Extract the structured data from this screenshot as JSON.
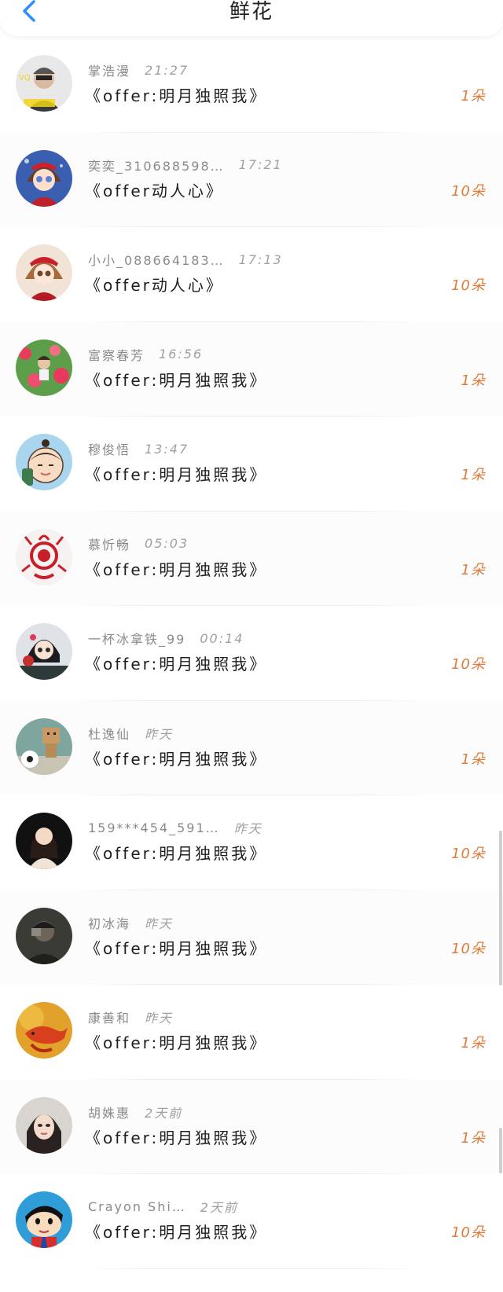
{
  "header": {
    "title": "鲜花",
    "back_icon": "chevron-left-icon",
    "accent": "#2f8cff"
  },
  "list": {
    "count_color": "#e07b3a",
    "items": [
      {
        "name": "掌浩漫",
        "time": "21:27",
        "gift": "《offer:明月独照我》",
        "count": "1朵"
      },
      {
        "name": "奕奕_310688598…",
        "time": "17:21",
        "gift": "《offer动人心》",
        "count": "10朵"
      },
      {
        "name": "小小_088664183…",
        "time": "17:13",
        "gift": "《offer动人心》",
        "count": "10朵"
      },
      {
        "name": "富察春芳",
        "time": "16:56",
        "gift": "《offer:明月独照我》",
        "count": "1朵"
      },
      {
        "name": "穆俊悟",
        "time": "13:47",
        "gift": "《offer:明月独照我》",
        "count": "1朵"
      },
      {
        "name": "慕忻畅",
        "time": "05:03",
        "gift": "《offer:明月独照我》",
        "count": "1朵"
      },
      {
        "name": "一杯冰拿铁_99",
        "time": "00:14",
        "gift": "《offer:明月独照我》",
        "count": "10朵"
      },
      {
        "name": "杜逸仙",
        "time": "昨天",
        "gift": "《offer:明月独照我》",
        "count": "1朵"
      },
      {
        "name": "159***454_591…",
        "time": "昨天",
        "gift": "《offer:明月独照我》",
        "count": "10朵"
      },
      {
        "name": "初冰海",
        "time": "昨天",
        "gift": "《offer:明月独照我》",
        "count": "10朵"
      },
      {
        "name": "康善和",
        "time": "昨天",
        "gift": "《offer:明月独照我》",
        "count": "1朵"
      },
      {
        "name": "胡姝惠",
        "time": "2天前",
        "gift": "《offer:明月独照我》",
        "count": "1朵"
      },
      {
        "name": "Crayon Shi…",
        "time": "2天前",
        "gift": "《offer:明月独照我》",
        "count": "10朵"
      }
    ]
  }
}
